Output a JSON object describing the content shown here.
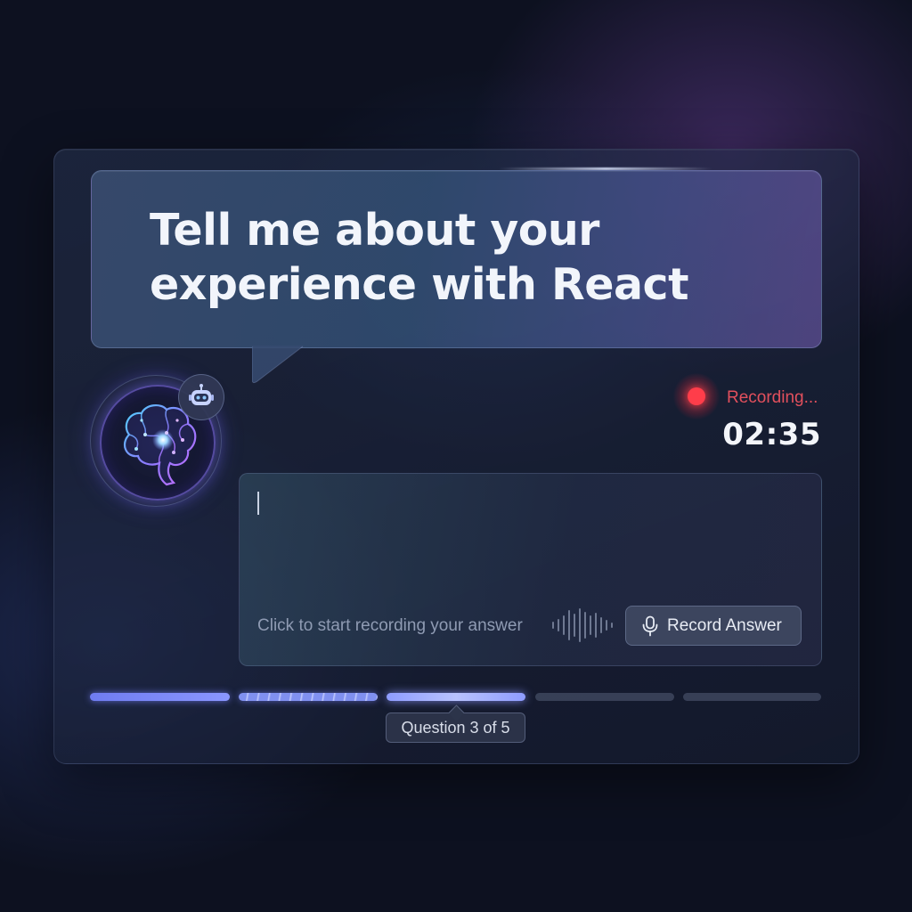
{
  "question": {
    "text": "Tell me about your experience with React"
  },
  "avatar": {
    "icon": "brain-icon",
    "badge_icon": "robot-icon"
  },
  "recording": {
    "status": "Recording...",
    "timer": "02:35",
    "indicator_color": "#ff3d4a"
  },
  "answer": {
    "value": "",
    "placeholder": "Click to start recording your answer",
    "waveform_icon": "waveform-icon",
    "record_button_label": "Record Answer",
    "record_button_icon": "microphone-icon"
  },
  "progress": {
    "current": 3,
    "total": 5,
    "label": "Question 3 of 5"
  },
  "colors": {
    "accent": "#8a96ff",
    "recording": "#e2505d",
    "background": "#0d1120"
  }
}
